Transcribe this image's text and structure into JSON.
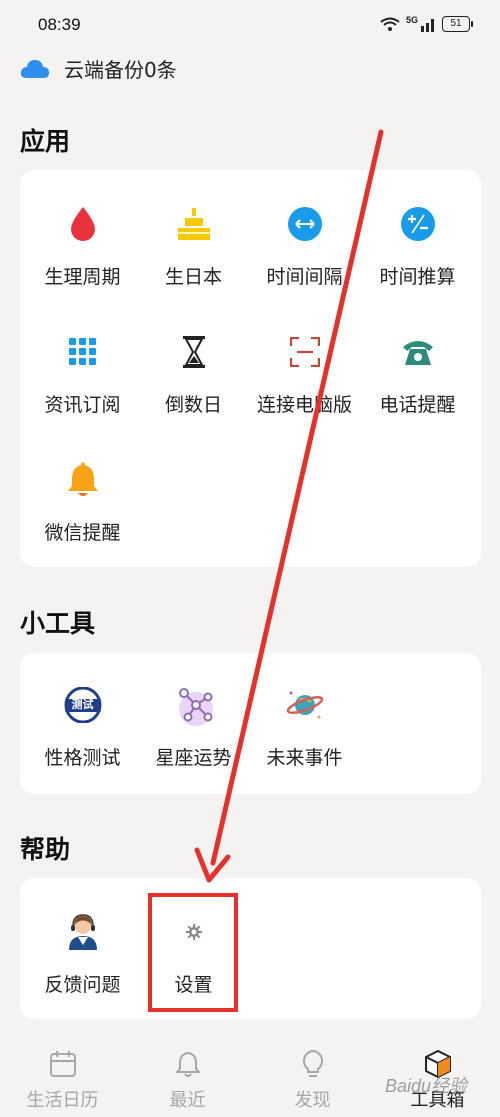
{
  "status_bar": {
    "time": "08:39",
    "battery": "51",
    "network": "5G"
  },
  "cloud": {
    "text": "云端备份0条",
    "icon": "cloud-icon"
  },
  "sections": {
    "apps": {
      "title": "应用",
      "items": [
        {
          "label": "生理周期",
          "icon": "blood-drop-icon"
        },
        {
          "label": "生日本",
          "icon": "birthday-cake-icon"
        },
        {
          "label": "时间间隔",
          "icon": "time-interval-icon"
        },
        {
          "label": "时间推算",
          "icon": "plus-minus-icon"
        },
        {
          "label": "资讯订阅",
          "icon": "grid-icon"
        },
        {
          "label": "倒数日",
          "icon": "hourglass-icon"
        },
        {
          "label": "连接电脑版",
          "icon": "scan-frame-icon"
        },
        {
          "label": "电话提醒",
          "icon": "telephone-icon"
        },
        {
          "label": "微信提醒",
          "icon": "bell-icon"
        }
      ]
    },
    "tools": {
      "title": "小工具",
      "items": [
        {
          "label": "性格测试",
          "icon": "test-badge-icon",
          "badge_text": "测试"
        },
        {
          "label": "星座运势",
          "icon": "constellation-icon"
        },
        {
          "label": "未来事件",
          "icon": "planet-icon"
        }
      ]
    },
    "help": {
      "title": "帮助",
      "items": [
        {
          "label": "反馈问题",
          "icon": "support-agent-icon"
        },
        {
          "label": "设置",
          "icon": "gear-icon"
        }
      ]
    }
  },
  "tabbar": [
    {
      "label": "生活日历",
      "icon": "calendar-icon",
      "active": false
    },
    {
      "label": "最近",
      "icon": "bell-outline-icon",
      "active": false
    },
    {
      "label": "发现",
      "icon": "lightbulb-icon",
      "active": false
    },
    {
      "label": "工具箱",
      "icon": "toolbox-cube-icon",
      "active": true
    }
  ],
  "colors": {
    "annotation_red": "#e4322b",
    "background": "#f4f3f1",
    "card": "#ffffff"
  },
  "watermark": "Baidu经验"
}
